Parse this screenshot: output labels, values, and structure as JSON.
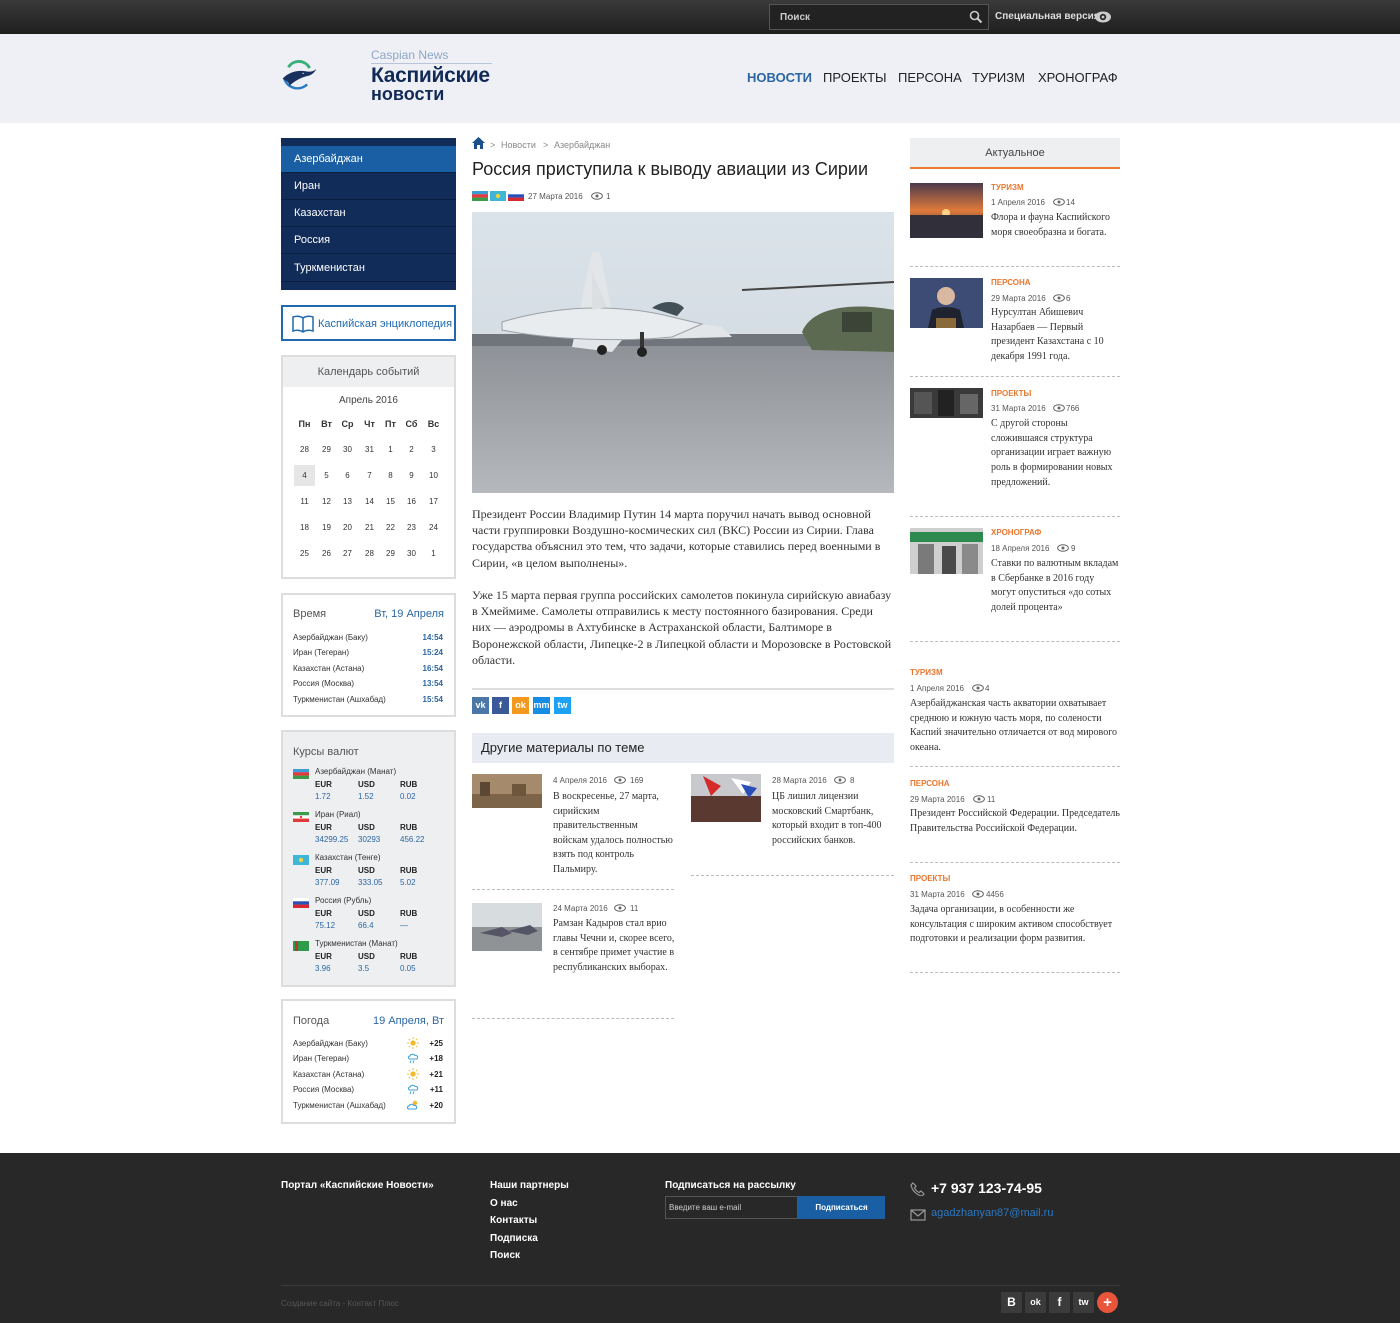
{
  "topbar": {
    "search_placeholder": "Поиск",
    "special_version": "Специальная версия"
  },
  "logo": {
    "en": "Caspian News",
    "ru_line1": "Каспийские",
    "ru_line2": "новости"
  },
  "nav": [
    "НОВОСТИ",
    "ПРОЕКТЫ",
    "ПЕРСОНА",
    "ТУРИЗМ",
    "ХРОНОГРАФ"
  ],
  "countries": [
    "Азербайджан",
    "Иран",
    "Казахстан",
    "Россия",
    "Туркменистан"
  ],
  "encyclopedia": "Каспийская энциклопедия",
  "calendar": {
    "title": "Календарь событий",
    "month": "Апрель 2016",
    "weekdays": [
      "Пн",
      "Вт",
      "Ср",
      "Чт",
      "Пт",
      "Сб",
      "Вс"
    ],
    "weeks": [
      [
        "28",
        "29",
        "30",
        "31",
        "1",
        "2",
        "3"
      ],
      [
        "4",
        "5",
        "6",
        "7",
        "8",
        "9",
        "10"
      ],
      [
        "11",
        "12",
        "13",
        "14",
        "15",
        "16",
        "17"
      ],
      [
        "18",
        "19",
        "20",
        "21",
        "22",
        "23",
        "24"
      ],
      [
        "25",
        "26",
        "27",
        "28",
        "29",
        "30",
        "1"
      ]
    ]
  },
  "time": {
    "title": "Время",
    "date": "Вт, 19 Апреля",
    "rows": [
      {
        "city": "Азербайджан (Баку)",
        "time": "14:54"
      },
      {
        "city": "Иран (Тегеран)",
        "time": "15:24"
      },
      {
        "city": "Казахстан (Астана)",
        "time": "16:54"
      },
      {
        "city": "Россия (Москва)",
        "time": "13:54"
      },
      {
        "city": "Туркменистан (Ашхабад)",
        "time": "15:54"
      }
    ]
  },
  "currency": {
    "title": "Курсы валют",
    "headers": [
      "EUR",
      "USD",
      "RUB"
    ],
    "rows": [
      {
        "name": "Азербайджан (Манат)",
        "values": [
          "1.72",
          "1.52",
          "0.02"
        ]
      },
      {
        "name": "Иран (Риал)",
        "values": [
          "34299.25",
          "30293",
          "456.22"
        ]
      },
      {
        "name": "Казахстан (Тенге)",
        "values": [
          "377.09",
          "333.05",
          "5.02"
        ]
      },
      {
        "name": "Россия (Рубль)",
        "values": [
          "75.12",
          "66.4",
          "—"
        ]
      },
      {
        "name": "Туркменистан (Манат)",
        "values": [
          "3.96",
          "3.5",
          "0.05"
        ]
      }
    ]
  },
  "weather": {
    "title": "Погода",
    "date": "19 Апреля, Вт",
    "rows": [
      {
        "city": "Азербайджан (Баку)",
        "icon": "sun-icon",
        "temp": "+25"
      },
      {
        "city": "Иран (Тегеран)",
        "icon": "cloud-rain-icon",
        "temp": "+18"
      },
      {
        "city": "Казахстан (Астана)",
        "icon": "sun-icon",
        "temp": "+21"
      },
      {
        "city": "Россия (Москва)",
        "icon": "cloud-rain-icon",
        "temp": "+11"
      },
      {
        "city": "Туркменистан (Ашхабад)",
        "icon": "partly-cloudy-icon",
        "temp": "+20"
      }
    ]
  },
  "article": {
    "breadcrumbs": [
      "Новости",
      "Азербайджан"
    ],
    "title": "Россия приступила к выводу авиации из Сирии",
    "date": "27 Марта 2016",
    "views": "1",
    "p1": "Президент России Владимир Путин 14 марта поручил начать вывод основной части группировки Воздушно-космических сил (ВКС) России из Сирии. Глава государства объяснил это тем, что задачи, которые ставились перед военными в Сирии, «в целом выполнены».",
    "p2": "Уже 15 марта первая группа российских самолетов покинула сирийскую авиабазу в Хмеймиме. Самолеты отправились к месту постоянного базирования. Среди них — аэродромы в Ахтубинске в Астраханской области, Балтиморе в Воронежской области, Липецке-2 в Липецкой области и Морозовске в Ростовской области."
  },
  "share": [
    "vk",
    "f",
    "ok",
    "mm",
    "tw"
  ],
  "other": {
    "title": "Другие материалы по теме",
    "items": [
      {
        "date": "4 Апреля 2016",
        "views": "169",
        "text": "В воскресенье, 27 марта, сирийским правительственным войскам удалось полностью взять под контроль Пальмиру."
      },
      {
        "date": "28 Марта 2016",
        "views": "8",
        "text": "ЦБ лишил лицензии московский Смартбанк, который входит в топ-400 российских банков."
      },
      {
        "date": "24 Марта 2016",
        "views": "11",
        "text": "Рамзан Кадыров стал врио главы Чечни и, скорее всего, в сентябре примет участие в республиканских выборах."
      }
    ]
  },
  "actual": {
    "title": "Актуальное",
    "items": [
      {
        "cat": "Туризм",
        "date": "1 Апреля 2016",
        "views": "14",
        "text": "Флора и фауна Каспийского моря своеобразна и богата."
      },
      {
        "cat": "Персона",
        "date": "29 Марта 2016",
        "views": "6",
        "text": "Нурсултан Абишевич Назарбаев — Первый президент Казахстана с 10 декабря 1991 года."
      },
      {
        "cat": "Проекты",
        "date": "31 Марта 2016",
        "views": "766",
        "text": "С другой стороны сложившаяся структура организации играет важную роль в формировании новых предложений."
      },
      {
        "cat": "Хронограф",
        "date": "18 Апреля 2016",
        "views": "9",
        "text": "Ставки по валютным вкладам в Сбербанке в 2016 году могут опуститься «до сотых долей процента»"
      }
    ],
    "text_items": [
      {
        "cat": "Туризм",
        "date": "1 Апреля 2016",
        "views": "4",
        "text": "Азербайджанская часть акватории охватывает среднюю и южную часть моря, по солености Каспий значительно отличается от вод мирового океана."
      },
      {
        "cat": "Персона",
        "date": "29 Марта 2016",
        "views": "11",
        "text": "Президент Российской Федерации. Председатель Правительства Российской Федерации."
      },
      {
        "cat": "Проекты",
        "date": "31 Марта 2016",
        "views": "4456",
        "text": "Задача организации, в особенности же консультация с широким активом способствует подготовки и реализации форм развития."
      }
    ]
  },
  "footer": {
    "portal": "Портал «Каспийские Новости»",
    "links": [
      "Наши партнеры",
      "О нас",
      "Контакты",
      "Подписка",
      "Поиск"
    ],
    "subscribe_title": "Подписаться на рассылку",
    "email_placeholder": "Введите ваш e-mail",
    "subscribe_button": "Подписаться",
    "phone": "+7 937 123-74-95",
    "email": "agadzhanyan87@mail.ru",
    "credit": "Создание сайта - Контакт Плюс",
    "social": [
      "В",
      "ok",
      "f",
      "tw",
      "+"
    ]
  },
  "colors": {
    "brand_navy": "#112c59",
    "accent_blue": "#1a5fa3",
    "category_orange": "#e8772e"
  }
}
